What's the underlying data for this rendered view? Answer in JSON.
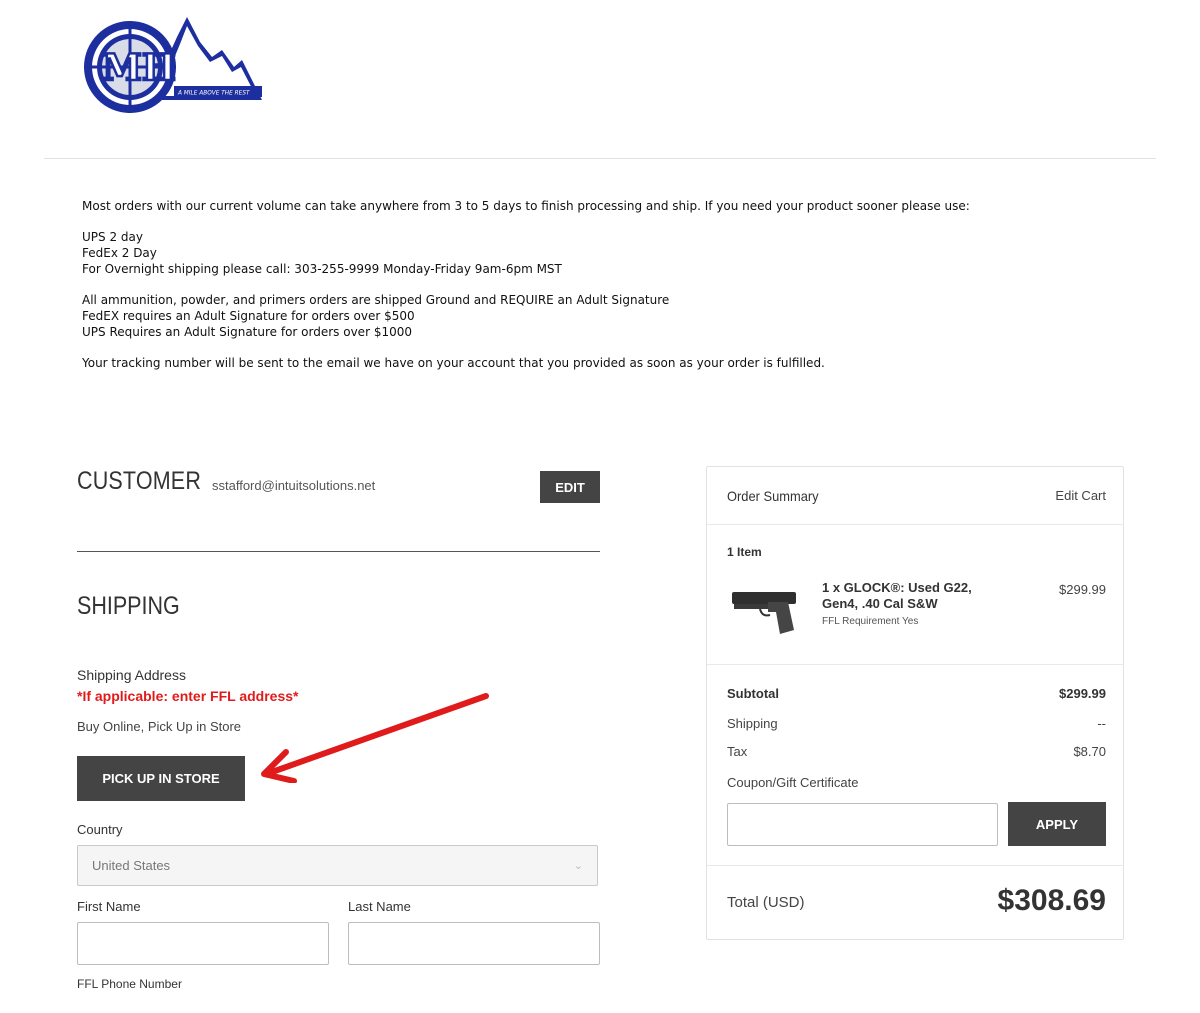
{
  "logo": {
    "text": "MH",
    "tagline": "A MILE ABOVE THE REST"
  },
  "notice": {
    "intro": "Most orders with our current volume can take anywhere from 3 to 5 days to finish processing and ship. If you need your product sooner please use:",
    "options": [
      "UPS 2 day",
      "FedEx 2 Day",
      "For Overnight shipping please call: 303-255-9999  Monday-Friday 9am-6pm MST"
    ],
    "signature": [
      "All ammunition, powder, and primers orders are shipped Ground and REQUIRE an Adult Signature",
      "FedEX requires an Adult Signature for orders over $500",
      "UPS Requires an Adult Signature for orders over $1000"
    ],
    "tracking": "Your tracking number will be sent to the email we have on your account that you provided as soon as your order is fulfilled."
  },
  "customer": {
    "heading": "CUSTOMER",
    "email": "sstafford@intuitsolutions.net",
    "edit_label": "EDIT"
  },
  "shipping": {
    "heading": "SHIPPING",
    "address_label": "Shipping Address",
    "ffl_note": "*If applicable: enter FFL address*",
    "bopis_label": "Buy Online, Pick Up in Store",
    "pickup_button": "PICK UP IN STORE",
    "country_label": "Country",
    "country_value": "United States",
    "first_name_label": "First Name",
    "last_name_label": "Last Name",
    "phone_label": "FFL Phone Number"
  },
  "summary": {
    "title": "Order Summary",
    "edit_cart": "Edit Cart",
    "item_count": "1 Item",
    "item": {
      "name": "1 x GLOCK®: Used G22, Gen4, .40 Cal S&W",
      "ffl": "FFL Requirement Yes",
      "price": "$299.99"
    },
    "subtotal_label": "Subtotal",
    "subtotal_value": "$299.99",
    "shipping_label": "Shipping",
    "shipping_value": "--",
    "tax_label": "Tax",
    "tax_value": "$8.70",
    "coupon_label": "Coupon/Gift Certificate",
    "apply_label": "APPLY",
    "total_label": "Total (USD)",
    "total_value": "$308.69"
  },
  "colors": {
    "accent_red": "#e01b1b",
    "button_dark": "#444444",
    "logo_blue": "#1d2f9e"
  }
}
